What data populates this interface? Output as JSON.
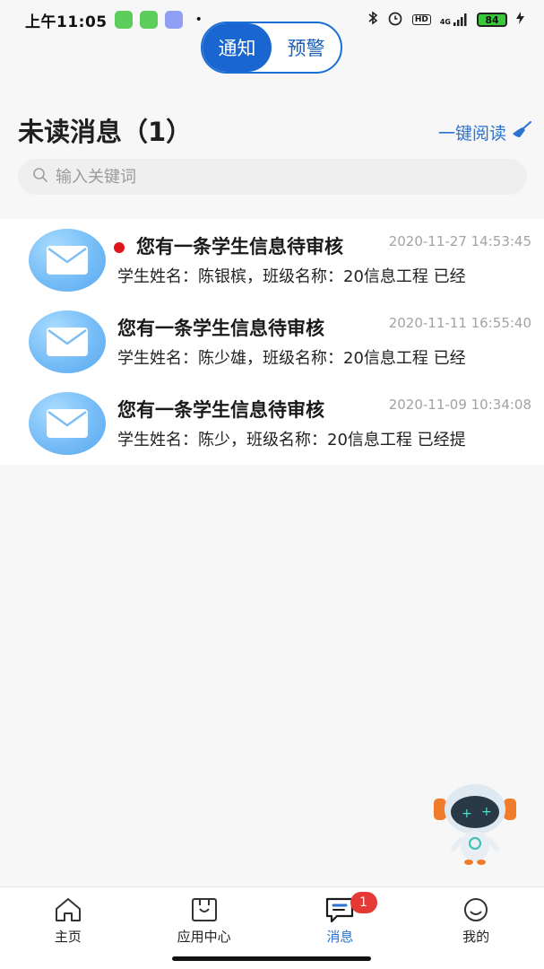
{
  "status_bar": {
    "time": "上午11:05",
    "dot": "•",
    "hd": "HD",
    "signal": "4G",
    "battery": "84"
  },
  "segment": {
    "tabs": [
      {
        "label": "通知",
        "active": true
      },
      {
        "label": "预警",
        "active": false
      }
    ]
  },
  "header": {
    "title": "未读消息（1）",
    "read_all_label": "一键阅读"
  },
  "search": {
    "placeholder": "输入关键词",
    "value": ""
  },
  "messages": [
    {
      "title": "您有一条学生信息待审核",
      "time": "2020-11-27 14:53:45",
      "summary": "学生姓名：陈银槟，班级名称：20信息工程 已经",
      "unread": true
    },
    {
      "title": "您有一条学生信息待审核",
      "time": "2020-11-11 16:55:40",
      "summary": "学生姓名：陈少雄，班级名称：20信息工程 已经",
      "unread": false
    },
    {
      "title": "您有一条学生信息待审核",
      "time": "2020-11-09 10:34:08",
      "summary": "学生姓名：陈少，班级名称：20信息工程 已经提",
      "unread": false
    }
  ],
  "bottom_nav": {
    "items": [
      {
        "label": "主页",
        "icon": "home-icon"
      },
      {
        "label": "应用中心",
        "icon": "apps-icon"
      },
      {
        "label": "消息",
        "icon": "message-icon",
        "active": true,
        "badge": "1"
      },
      {
        "label": "我的",
        "icon": "profile-icon"
      }
    ]
  },
  "colors": {
    "accent": "#1a66d0",
    "badge": "#e53935",
    "unread_dot": "#e0151b"
  }
}
